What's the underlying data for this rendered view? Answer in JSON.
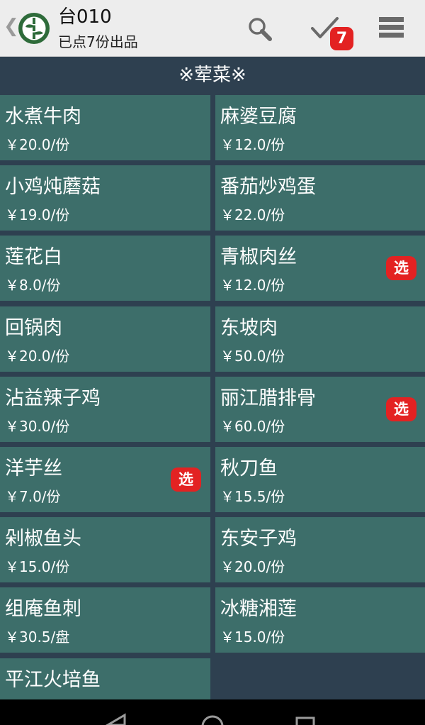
{
  "header": {
    "title": "台010",
    "subtitle": "已点7份出品",
    "cart_count": "7",
    "back_glyph": "❮",
    "icons": {
      "back": "chevron-left-icon",
      "logo": "bamboo-logo-icon",
      "search": "search-icon",
      "check": "checkmark-icon",
      "menu": "list-menu-icon"
    }
  },
  "category": {
    "title": "※荤菜※"
  },
  "selected_label": "选",
  "colors": {
    "appbar": "#ededed",
    "page_background": "#2e4050",
    "tile": "#3d6e6a",
    "badge": "#e32222",
    "logo": "#2e6b3a"
  },
  "dishes": [
    {
      "name": "水煮牛肉",
      "price": "￥20.0/份",
      "selected": false
    },
    {
      "name": "麻婆豆腐",
      "price": "￥12.0/份",
      "selected": false
    },
    {
      "name": "小鸡炖蘑菇",
      "price": "￥19.0/份",
      "selected": false
    },
    {
      "name": "番茄炒鸡蛋",
      "price": "￥22.0/份",
      "selected": false
    },
    {
      "name": "莲花白",
      "price": "￥8.0/份",
      "selected": false
    },
    {
      "name": "青椒肉丝",
      "price": "￥12.0/份",
      "selected": true
    },
    {
      "name": "回锅肉",
      "price": "￥20.0/份",
      "selected": false
    },
    {
      "name": "东坡肉",
      "price": "￥50.0/份",
      "selected": false
    },
    {
      "name": "沾益辣子鸡",
      "price": "￥30.0/份",
      "selected": false
    },
    {
      "name": "丽江腊排骨",
      "price": "￥60.0/份",
      "selected": true
    },
    {
      "name": "洋芋丝",
      "price": "￥7.0/份",
      "selected": true
    },
    {
      "name": "秋刀鱼",
      "price": "￥15.5/份",
      "selected": false
    },
    {
      "name": "剁椒鱼头",
      "price": "￥15.0/份",
      "selected": false
    },
    {
      "name": "东安子鸡",
      "price": "￥20.0/份",
      "selected": false
    },
    {
      "name": "组庵鱼刺",
      "price": "￥30.5/盘",
      "selected": false
    },
    {
      "name": "冰糖湘莲",
      "price": "￥15.0/份",
      "selected": false
    },
    {
      "name": "平江火培鱼",
      "price": "",
      "selected": false
    }
  ],
  "system_nav": {
    "icons": [
      "nav-back-icon",
      "nav-home-icon",
      "nav-recents-icon"
    ]
  }
}
